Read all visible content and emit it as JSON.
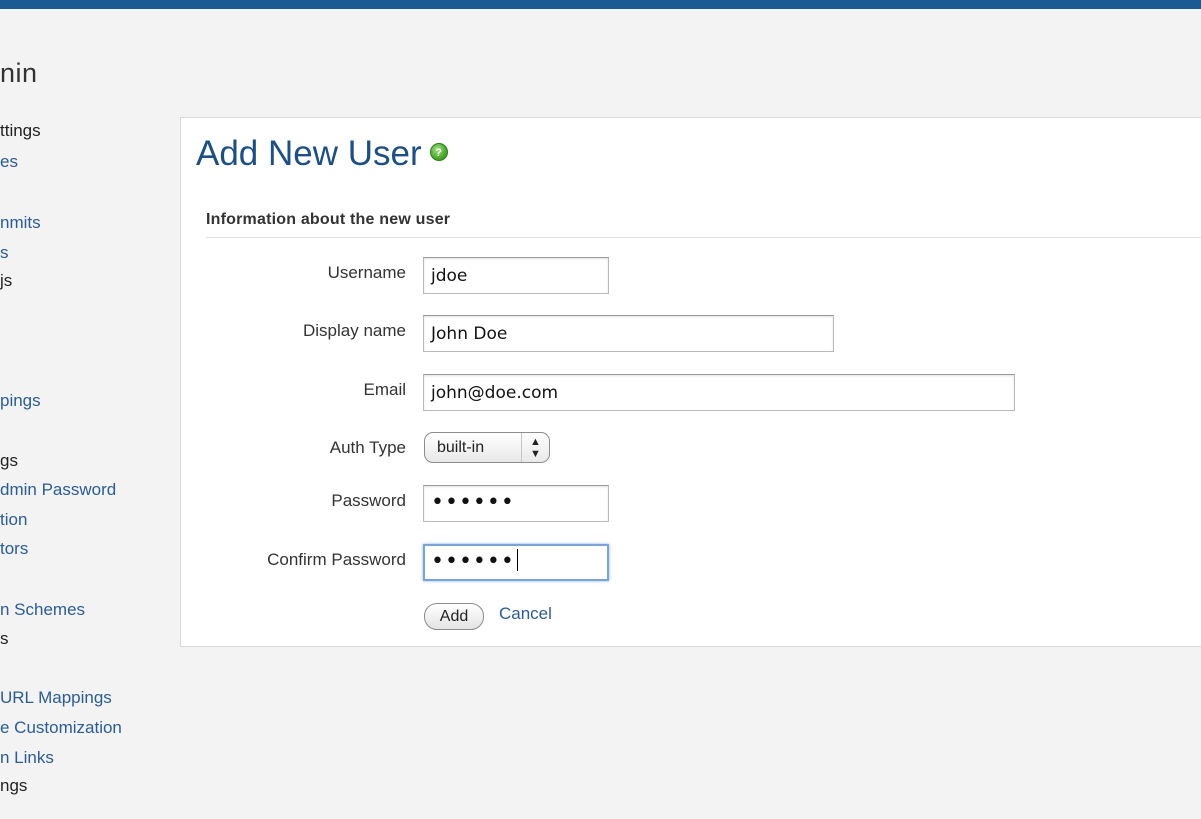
{
  "header": {
    "page_heading": "nin"
  },
  "sidebar": {
    "items": [
      {
        "label": "ttings",
        "link": false
      },
      {
        "label": "es",
        "link": true
      },
      {
        "label": "nmits",
        "link": true
      },
      {
        "label": "s",
        "link": true
      },
      {
        "label": "js",
        "link": false
      },
      {
        "label": "pings",
        "link": true
      },
      {
        "label": "gs",
        "link": false
      },
      {
        "label": "dmin Password",
        "link": true
      },
      {
        "label": "tion",
        "link": true
      },
      {
        "label": "tors",
        "link": true
      },
      {
        "label": "n Schemes",
        "link": true
      },
      {
        "label": "s",
        "link": false
      },
      {
        "label": "URL Mappings",
        "link": true
      },
      {
        "label": "e Customization",
        "link": true
      },
      {
        "label": "n Links",
        "link": true
      },
      {
        "label": "ngs",
        "link": false
      }
    ]
  },
  "form": {
    "title": "Add New User",
    "help_icon": "help-icon",
    "section_title": "Information about the new user",
    "username_label": "Username",
    "username_value": "jdoe",
    "display_name_label": "Display name",
    "display_name_value": "John Doe",
    "email_label": "Email",
    "email_value": "john@doe.com",
    "auth_type_label": "Auth Type",
    "auth_type_value": "built-in",
    "password_label": "Password",
    "password_mask": "••••••",
    "confirm_password_label": "Confirm Password",
    "confirm_password_mask": "••••••",
    "add_button": "Add",
    "cancel_link": "Cancel"
  },
  "colors": {
    "topbar": "#1c5a93",
    "link": "#2a5d95",
    "title": "#1c4f86",
    "help_icon": "#4fae2d"
  }
}
